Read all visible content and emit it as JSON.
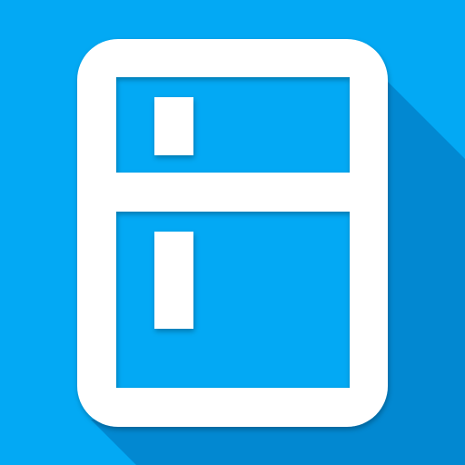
{
  "app_icon": {
    "icon": "refrigerator-icon",
    "colors": {
      "background": "#03A9F4",
      "long_shadow": "#0288D1",
      "glyph": "#FFFFFF"
    }
  }
}
